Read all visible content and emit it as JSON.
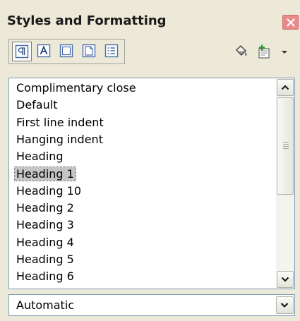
{
  "window": {
    "title": "Styles and Formatting"
  },
  "toolbar": {
    "buttons": [
      {
        "icon": "paragraph-styles-icon",
        "active": true
      },
      {
        "icon": "character-styles-icon"
      },
      {
        "icon": "frame-styles-icon"
      },
      {
        "icon": "page-styles-icon"
      },
      {
        "icon": "list-styles-icon"
      },
      {
        "icon": "fill-format-mode-icon"
      },
      {
        "icon": "new-style-from-selection-icon"
      },
      {
        "icon": "dropdown-arrow-icon"
      }
    ]
  },
  "styles_list": {
    "items": [
      "Complimentary close",
      "Default",
      "First line indent",
      "Hanging indent",
      "Heading",
      "Heading 1",
      "Heading 10",
      "Heading 2",
      "Heading 3",
      "Heading 4",
      "Heading 5",
      "Heading 6"
    ],
    "selected": "Heading 1"
  },
  "filter": {
    "value": "Automatic"
  },
  "colors": {
    "panel_bg": "#ece9d8",
    "close_button": "#e98a8a",
    "border": "#7f9db9",
    "selection": "#c5c5c5"
  }
}
